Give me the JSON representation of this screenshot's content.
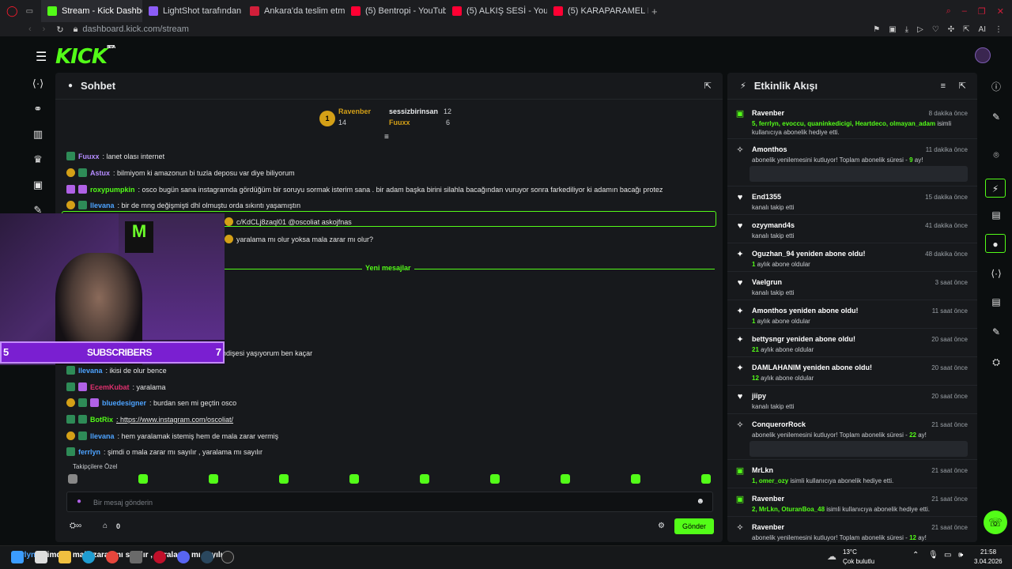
{
  "browser": {
    "tabs": [
      {
        "label": "Stream - Kick Dashboard",
        "color": "#53fc18",
        "active": true
      },
      {
        "label": "LightShot tarafından Ekra",
        "color": "#8b5cf6",
        "active": false
      },
      {
        "label": "Ankara'da teslim etmesi g",
        "color": "#d11f3a",
        "active": false
      },
      {
        "label": "(5) Bentropi - YouTube",
        "color": "#ff0033",
        "active": false
      },
      {
        "label": "(5) ALKIŞ SESİ - YouTube",
        "color": "#ff0033",
        "active": false
      },
      {
        "label": "(5) KARAPARAMEL FETTO",
        "color": "#ff0033",
        "active": false
      }
    ],
    "url": "dashboard.kick.com/stream"
  },
  "logo": "KICK",
  "logo_badge": "BETA",
  "chat": {
    "title": "Sohbet",
    "leaderboard": {
      "first": {
        "rank": "1",
        "name": "Ravenber",
        "count": "14"
      },
      "second": {
        "name": "sessizbirinsan",
        "count": "12"
      },
      "third": {
        "name": "Fuuxx",
        "count": "6"
      }
    },
    "messages": [
      {
        "user": "Fuuxx",
        "text": ": lanet olası internet",
        "color": "#b58cff"
      },
      {
        "user": "Astux",
        "text": ": bilmiyom ki amazonun bi tuzla deposu var diye biliyorum",
        "color": "#b58cff"
      },
      {
        "user": "roxypumpkin",
        "text": ": osco bugün sana instagramda gördüğüm bir soruyu sormak isterim sana . bir adam başka birini silahla bacağından vuruyor sonra farkediliyor ki adamın bacağı protez",
        "color": "#53fc18"
      },
      {
        "user": "llevana",
        "text": ": bir de mng değişmişti dhl olmuştu orda sıkıntı yaşamıştın",
        "color": "#4da3ff"
      },
      {
        "user": "",
        "text": "c/KdCLj8zaql01 @oscoliat askojfnas",
        "color": "#4da3ff"
      },
      {
        "user": "",
        "text": "yaralama mı olur yoksa mala zarar mı olur?",
        "color": "#4da3ff"
      },
      {
        "user": "",
        "text": "efa internetim bitecek endişesi yaşıyorum ben kaçar",
        "color": "#4da3ff"
      },
      {
        "user": "llevana",
        "text": ": ikisi de olur bence",
        "color": "#4da3ff"
      },
      {
        "user": "EcemKubat",
        "text": ": yaralama",
        "color": "#e0306e"
      },
      {
        "user": "bluedesigner",
        "text": ": burdan sen mi geçtin osco",
        "color": "#4da3ff"
      },
      {
        "user": "BotRix",
        "text": ": https://www.instagram.com/oscoliat/",
        "color": "#53fc18"
      },
      {
        "user": "llevana",
        "text": ": hem yaralamak istemiş hem de mala zarar vermiş",
        "color": "#4da3ff"
      },
      {
        "user": "ferrlyn",
        "text": ": şimdi o mala zarar mı sayılır , yaralama mı sayılır",
        "color": "#4da3ff"
      }
    ],
    "new_messages": "Yeni mesajlar",
    "followers_only": "Takipçilere Özel",
    "input_placeholder": "Bir mesaj gönderin",
    "count": "0",
    "send": "Gönder"
  },
  "cam": {
    "subs_count": "5",
    "subs_label": "SUBSCRIBERS",
    "subs_goal": "7"
  },
  "activity": {
    "title": "Etkinlik Akışı",
    "items": [
      {
        "name": "Ravenber",
        "time": "8 dakika önce",
        "desc_green": "5, ferrlyn, evoccu, quaninkedicigi, Heartdeco, olmayan_adam",
        "desc": " isimli kullanıcıya abonelik hediye etti.",
        "icon": "gift-icon"
      },
      {
        "name": "Amonthos",
        "time": "11 dakika önce",
        "desc": "abonelik yenilemesini kutluyor! Toplam abonelik süresi - ",
        "desc_green": "9",
        "desc2": " ay!",
        "icon": "star-icon"
      },
      {
        "name": "End1355",
        "time": "15 dakika önce",
        "desc": "kanalı takip etti",
        "icon": "heart-icon"
      },
      {
        "name": "ozyymand4s",
        "time": "41 dakika önce",
        "desc": "kanalı takip etti",
        "icon": "heart-icon"
      },
      {
        "name": "Oguzhan_94 yeniden abone oldu!",
        "time": "48 dakika önce",
        "desc_green": "1",
        "desc": " aylık abone oldular",
        "icon": "sparkle-icon"
      },
      {
        "name": "Vaelgrun",
        "time": "3 saat önce",
        "desc": "kanalı takip etti",
        "icon": "heart-icon"
      },
      {
        "name": "Amonthos yeniden abone oldu!",
        "time": "11 saat önce",
        "desc_green": "1",
        "desc": " aylık abone oldular",
        "icon": "sparkle-icon"
      },
      {
        "name": "bettysngr yeniden abone oldu!",
        "time": "20 saat önce",
        "desc_green": "21",
        "desc": " aylık abone oldular",
        "icon": "sparkle-icon"
      },
      {
        "name": "DAMLAHANIM yeniden abone oldu!",
        "time": "20 saat önce",
        "desc_green": "12",
        "desc": " aylık abone oldular",
        "icon": "sparkle-icon"
      },
      {
        "name": "jiipy",
        "time": "20 saat önce",
        "desc": "kanalı takip etti",
        "icon": "heart-icon"
      },
      {
        "name": "ConquerorRock",
        "time": "21 saat önce",
        "desc": "abonelik yenilemesini kutluyor! Toplam abonelik süresi - ",
        "desc_green": "22",
        "desc2": " ay!",
        "icon": "star-icon"
      },
      {
        "name": "MrLkn",
        "time": "21 saat önce",
        "desc_green": "1, omer_ozy",
        "desc": " isimli kullanıcıya abonelik hediye etti.",
        "icon": "gift-icon"
      },
      {
        "name": "Ravenber",
        "time": "21 saat önce",
        "desc_green": "2, MrLkn, OturanBoa_48",
        "desc": " isimli kullanıcıya abonelik hediye etti.",
        "icon": "gift-icon"
      },
      {
        "name": "Ravenber",
        "time": "21 saat önce",
        "desc": "abonelik yenilemesini kutluyor! Toplam abonelik süresi - ",
        "desc_green": "12",
        "desc2": " ay!",
        "icon": "star-icon"
      }
    ]
  },
  "taskbar": {
    "ticker_user": "ferrlyn",
    "ticker": ": şimdi o mala zarar mı sayılır , yaralama mı sayılır",
    "temp": "13°C",
    "weather": "Çok bulutlu",
    "time": "21:58",
    "date": "3.04.2026"
  }
}
